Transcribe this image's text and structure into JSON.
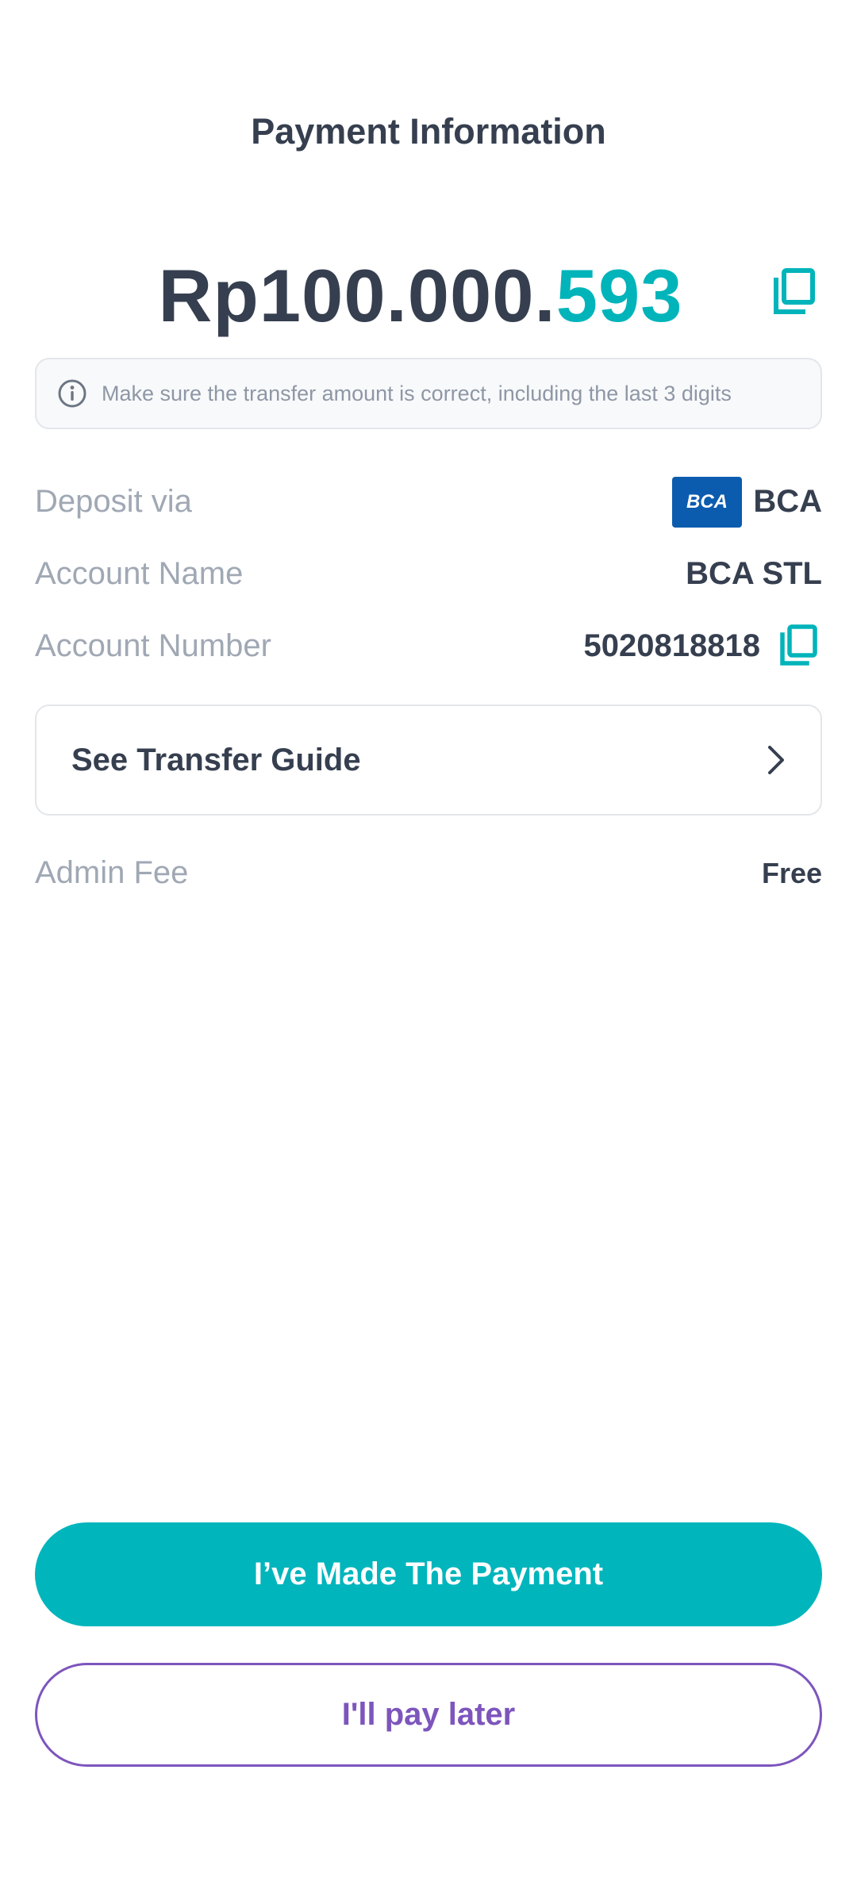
{
  "header": {
    "title": "Payment Information"
  },
  "payment": {
    "amount_main": "Rp100.000.",
    "amount_unique": "593",
    "copy_amount_icon": "copy-icon",
    "notice": "Make sure the transfer amount is correct, including the last 3 digits",
    "notice_icon": "info-icon"
  },
  "details": {
    "deposit_label": "Deposit via",
    "deposit_value": "BCA",
    "bank_logo_text": "BCA",
    "account_name_label": "Account Name",
    "account_name_value": "BCA STL",
    "account_number_label": "Account Number",
    "account_number_value": "5020818818",
    "copy_account_icon": "copy-icon"
  },
  "guide": {
    "label": "See Transfer Guide",
    "icon": "chevron-right-icon"
  },
  "fee": {
    "label": "Admin Fee",
    "value": "Free"
  },
  "actions": {
    "primary": "I’ve Made The Payment",
    "secondary": "I'll pay later"
  },
  "colors": {
    "accent": "#00b5bc",
    "secondary": "#7d55bd",
    "text": "#363f4f",
    "muted": "#a0a8b4"
  }
}
